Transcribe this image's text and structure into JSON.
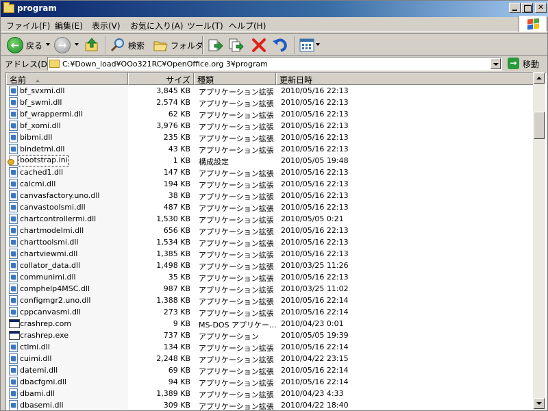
{
  "window": {
    "title": "program"
  },
  "menu": [
    {
      "label": "ファイル(F)"
    },
    {
      "label": "編集(E)"
    },
    {
      "label": "表示(V)"
    },
    {
      "label": "お気に入り(A)"
    },
    {
      "label": "ツール(T)"
    },
    {
      "label": "ヘルプ(H)"
    }
  ],
  "toolbar": {
    "back_label": "戻る",
    "search_label": "検索",
    "folders_label": "フォルダ"
  },
  "address": {
    "label": "アドレス(D)",
    "path": "C:¥Down_load¥OOo321RC¥OpenOffice.org 3¥program",
    "go_label": "移動"
  },
  "columns": {
    "name": "名前",
    "size": "サイズ",
    "type": "種類",
    "modified": "更新日時"
  },
  "files": [
    {
      "name": "bf_svxmi.dll",
      "size": "3,845 KB",
      "type": "アプリケーション拡張",
      "date": "2010/05/16 22:13",
      "icon": "dll"
    },
    {
      "name": "bf_swmi.dll",
      "size": "2,574 KB",
      "type": "アプリケーション拡張",
      "date": "2010/05/16 22:13",
      "icon": "dll"
    },
    {
      "name": "bf_wrappermi.dll",
      "size": "62 KB",
      "type": "アプリケーション拡張",
      "date": "2010/05/16 22:13",
      "icon": "dll"
    },
    {
      "name": "bf_xomi.dll",
      "size": "3,976 KB",
      "type": "アプリケーション拡張",
      "date": "2010/05/16 22:13",
      "icon": "dll"
    },
    {
      "name": "bibmi.dll",
      "size": "235 KB",
      "type": "アプリケーション拡張",
      "date": "2010/05/16 22:13",
      "icon": "dll"
    },
    {
      "name": "bindetmi.dll",
      "size": "43 KB",
      "type": "アプリケーション拡張",
      "date": "2010/05/16 22:13",
      "icon": "dll"
    },
    {
      "name": "bootstrap.ini",
      "size": "1 KB",
      "type": "構成設定",
      "date": "2010/05/05 19:48",
      "icon": "ini",
      "selected": true
    },
    {
      "name": "cached1.dll",
      "size": "147 KB",
      "type": "アプリケーション拡張",
      "date": "2010/05/16 22:13",
      "icon": "dll"
    },
    {
      "name": "calcmi.dll",
      "size": "194 KB",
      "type": "アプリケーション拡張",
      "date": "2010/05/16 22:13",
      "icon": "dll"
    },
    {
      "name": "canvasfactory.uno.dll",
      "size": "38 KB",
      "type": "アプリケーション拡張",
      "date": "2010/05/16 22:13",
      "icon": "dll"
    },
    {
      "name": "canvastoolsmi.dll",
      "size": "487 KB",
      "type": "アプリケーション拡張",
      "date": "2010/05/16 22:13",
      "icon": "dll"
    },
    {
      "name": "chartcontrollermi.dll",
      "size": "1,530 KB",
      "type": "アプリケーション拡張",
      "date": "2010/05/05 0:21",
      "icon": "dll"
    },
    {
      "name": "chartmodelmi.dll",
      "size": "656 KB",
      "type": "アプリケーション拡張",
      "date": "2010/05/16 22:13",
      "icon": "dll"
    },
    {
      "name": "charttoolsmi.dll",
      "size": "1,534 KB",
      "type": "アプリケーション拡張",
      "date": "2010/05/16 22:13",
      "icon": "dll"
    },
    {
      "name": "chartviewmi.dll",
      "size": "1,385 KB",
      "type": "アプリケーション拡張",
      "date": "2010/05/16 22:13",
      "icon": "dll"
    },
    {
      "name": "collator_data.dll",
      "size": "1,498 KB",
      "type": "アプリケーション拡張",
      "date": "2010/03/25 11:26",
      "icon": "dll"
    },
    {
      "name": "communimi.dll",
      "size": "35 KB",
      "type": "アプリケーション拡張",
      "date": "2010/05/16 22:13",
      "icon": "dll"
    },
    {
      "name": "comphelp4MSC.dll",
      "size": "987 KB",
      "type": "アプリケーション拡張",
      "date": "2010/03/25 11:02",
      "icon": "dll"
    },
    {
      "name": "configmgr2.uno.dll",
      "size": "1,388 KB",
      "type": "アプリケーション拡張",
      "date": "2010/05/16 22:14",
      "icon": "dll"
    },
    {
      "name": "cppcanvasmi.dll",
      "size": "273 KB",
      "type": "アプリケーション拡張",
      "date": "2010/05/16 22:14",
      "icon": "dll"
    },
    {
      "name": "crashrep.com",
      "size": "9 KB",
      "type": "MS-DOS アプリケー...",
      "date": "2010/04/23 0:01",
      "icon": "exe"
    },
    {
      "name": "crashrep.exe",
      "size": "737 KB",
      "type": "アプリケーション",
      "date": "2010/05/05 19:39",
      "icon": "exe"
    },
    {
      "name": "ctlmi.dll",
      "size": "134 KB",
      "type": "アプリケーション拡張",
      "date": "2010/05/16 22:14",
      "icon": "dll"
    },
    {
      "name": "cuimi.dll",
      "size": "2,248 KB",
      "type": "アプリケーション拡張",
      "date": "2010/04/22 23:15",
      "icon": "dll"
    },
    {
      "name": "datemi.dll",
      "size": "69 KB",
      "type": "アプリケーション拡張",
      "date": "2010/05/16 22:14",
      "icon": "dll"
    },
    {
      "name": "dbacfgmi.dll",
      "size": "94 KB",
      "type": "アプリケーション拡張",
      "date": "2010/05/16 22:14",
      "icon": "dll"
    },
    {
      "name": "dbami.dll",
      "size": "1,389 KB",
      "type": "アプリケーション拡張",
      "date": "2010/04/23 4:33",
      "icon": "dll"
    },
    {
      "name": "dbasemi.dll",
      "size": "309 KB",
      "type": "アプリケーション拡張",
      "date": "2010/04/22 18:40",
      "icon": "dll"
    }
  ]
}
